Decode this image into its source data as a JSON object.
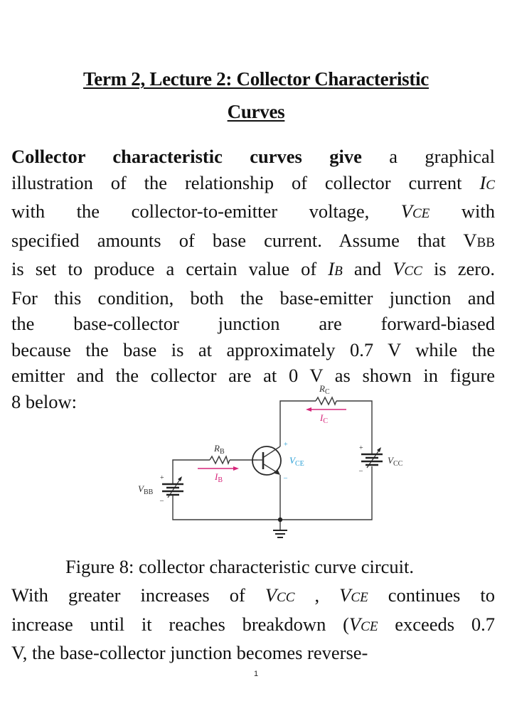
{
  "document": {
    "title_line1": "Term 2, Lecture 2: Collector Characteristic",
    "title_line2": "Curves",
    "paragraph1": {
      "lines": [
        {
          "bold": "Collector characteristic curves give",
          "text": " a graphical"
        },
        {
          "text": "illustration of the relationship of collector current ",
          "italic": "I",
          "italic_sub": "C"
        },
        {
          "text": "with the collector-to-emitter voltage, ",
          "italic": "V",
          "italic_sub": "CE",
          "tail": " with"
        },
        {
          "text": "specified amounts of base current. Assume that V",
          "sub": "BB"
        },
        {
          "text": "is set to produce a certain value of ",
          "italic": "I",
          "italic_sub": "B",
          "mid": " and ",
          "italic2": "V",
          "italic2_sub": "CC",
          "tail": " is zero."
        },
        {
          "text": "For this condition, both the base-emitter junction and"
        },
        {
          "text": "the base-collector junction are forward-biased"
        },
        {
          "text": "because the base is at approximately 0.7 V while the"
        },
        {
          "text": "emitter and the collector are at 0 V as shown in figure"
        },
        {
          "text": "8 below:"
        }
      ]
    },
    "figure": {
      "caption": "Figure 8: collector characteristic curve circuit.",
      "labels": {
        "rc": "R",
        "rc_sub": "C",
        "ic": "I",
        "ic_sub": "C",
        "rb": "R",
        "rb_sub": "B",
        "ib": "I",
        "ib_sub": "B",
        "vce": "V",
        "vce_sub": "CE",
        "vbb": "V",
        "vbb_sub": "BB",
        "vcc": "V",
        "vcc_sub": "CC",
        "plus": "+",
        "minus": "–"
      },
      "colors": {
        "current_arrow": "#d6257a",
        "vce_label": "#2a9fd6",
        "wire": "#3a3a3a"
      }
    },
    "paragraph2": {
      "lines": [
        {
          "text": "With greater increases of ",
          "italic": "V",
          "italic_sub": "CC",
          "mid": " , ",
          "italic2": "V",
          "italic2_sub": "CE",
          "tail": " continues to"
        },
        {
          "text": "increase until it reaches breakdown (",
          "italic": "V",
          "italic_sub": "CE",
          "tail": " exceeds 0.7"
        },
        {
          "text": "V, the base-collector junction becomes reverse-"
        }
      ]
    },
    "page_number": "1"
  }
}
